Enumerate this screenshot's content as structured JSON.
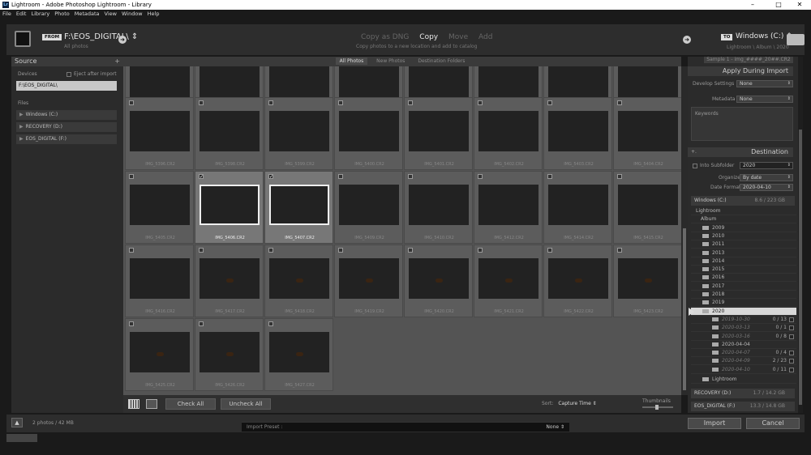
{
  "window": {
    "title": "Lightroom - Adobe Photoshop Lightroom - Library",
    "app_glyph": "Lr",
    "minimize": "–",
    "maximize": "□",
    "close": "✕"
  },
  "menu": [
    "File",
    "Edit",
    "Library",
    "Photo",
    "Metadata",
    "View",
    "Window",
    "Help"
  ],
  "topbar": {
    "from_label": "FROM",
    "from_path": "F:\\EOS_DIGITAL\\ ⇕",
    "from_sub": "All photos",
    "modes": [
      "Copy as DNG",
      "Copy",
      "Move",
      "Add"
    ],
    "active_mode": "Copy",
    "mode_sub": "Copy photos to a new location and add to catalog",
    "to_label": "TO",
    "to_path": "Windows (C:) ⇕",
    "to_sub": "Lightroom \\ Album \\ 2020",
    "arrow": "➜"
  },
  "source": {
    "title": "Source",
    "plus": "+",
    "devices_label": "Devices",
    "eject_label": "Eject after import",
    "selected_device": "F:\\EOS_DIGITAL\\",
    "files_label": "Files",
    "files": [
      {
        "name": "Windows (C:)"
      },
      {
        "name": "RECOVERY (D:)"
      },
      {
        "name": "EOS_DIGITAL (F:)"
      }
    ],
    "expand_glyph": "▶"
  },
  "grid": {
    "tabs": [
      "All Photos",
      "New Photos",
      "Destination Folders"
    ],
    "active_tab": "All Photos",
    "rows": [
      [
        {
          "label": "IMG_5387.CR2",
          "t": "t-grass",
          "sel": false
        },
        {
          "label": "IMG_5388.CR2",
          "t": "t-grass",
          "sel": false
        },
        {
          "label": "IMG_5389.CR2",
          "t": "t-grass",
          "sel": false
        },
        {
          "label": "IMG_5390.CR2",
          "t": "t-grass",
          "sel": false
        },
        {
          "label": "IMG_5391.CR2",
          "t": "t-grass",
          "sel": false
        },
        {
          "label": "IMG_5392.CR2",
          "t": "t-grass",
          "sel": false
        },
        {
          "label": "IMG_5393.CR2",
          "t": "t-grass",
          "sel": false
        },
        {
          "label": "IMG_5394.CR2",
          "t": "t-grass",
          "sel": false
        }
      ],
      [
        {
          "label": "IMG_5396.CR2",
          "t": "t-dark",
          "sel": false
        },
        {
          "label": "IMG_5398.CR2",
          "t": "t-grass",
          "sel": false
        },
        {
          "label": "IMG_5399.CR2",
          "t": "t-crocus2",
          "sel": false
        },
        {
          "label": "IMG_5400.CR2",
          "t": "t-crocus",
          "sel": false
        },
        {
          "label": "IMG_5401.CR2",
          "t": "t-crocus",
          "sel": false
        },
        {
          "label": "IMG_5402.CR2",
          "t": "t-crocus",
          "sel": false
        },
        {
          "label": "IMG_5403.CR2",
          "t": "t-crocus",
          "sel": false
        },
        {
          "label": "IMG_5404.CR2",
          "t": "t-crocus",
          "sel": false
        }
      ],
      [
        {
          "label": "IMG_5405.CR2",
          "t": "t-anem",
          "sel": false
        },
        {
          "label": "IMG_5406.CR2",
          "t": "t-anem",
          "sel": true
        },
        {
          "label": "IMG_5407.CR2",
          "t": "t-anem",
          "sel": true
        },
        {
          "label": "IMG_5409.CR2",
          "t": "t-yellow",
          "sel": false
        },
        {
          "label": "IMG_5410.CR2",
          "t": "t-yellow",
          "sel": false
        },
        {
          "label": "IMG_5412.CR2",
          "t": "t-yellow2",
          "sel": false
        },
        {
          "label": "IMG_5414.CR2",
          "t": "t-coltf",
          "sel": false
        },
        {
          "label": "IMG_5415.CR2",
          "t": "t-coltf",
          "sel": false
        }
      ],
      [
        {
          "label": "IMG_5416.CR2",
          "t": "t-black",
          "sel": false
        },
        {
          "label": "IMG_5417.CR2",
          "t": "t-bug",
          "sel": false,
          "bug": true
        },
        {
          "label": "IMG_5418.CR2",
          "t": "t-bug",
          "sel": false,
          "bug": true
        },
        {
          "label": "IMG_5419.CR2",
          "t": "t-bug2",
          "sel": false,
          "bug": true
        },
        {
          "label": "IMG_5420.CR2",
          "t": "t-bug2",
          "sel": false,
          "bug": true
        },
        {
          "label": "IMG_5421.CR2",
          "t": "t-bug2",
          "sel": false,
          "bug": true
        },
        {
          "label": "IMG_5422.CR2",
          "t": "t-bug3",
          "sel": false,
          "bug": true
        },
        {
          "label": "IMG_5423.CR2",
          "t": "t-bug3",
          "sel": false,
          "bug": true
        }
      ],
      [
        {
          "label": "IMG_5425.CR2",
          "t": "t-bug3",
          "sel": false,
          "bug": true
        },
        {
          "label": "IMG_5426.CR2",
          "t": "t-bug2",
          "sel": false,
          "bug": true
        },
        {
          "label": "IMG_5427.CR2",
          "t": "t-bug3",
          "sel": false,
          "bug": true
        }
      ]
    ],
    "check_glyph": "✓"
  },
  "grid_footer": {
    "check_all": "Check All",
    "uncheck_all": "Uncheck All",
    "sort_label": "Sort:",
    "sort_value": "Capture Time ⇕",
    "thumbnails_label": "Thumbnails"
  },
  "right": {
    "preset_top": "Sample 1 - img_####_20##.CR2",
    "apply_title": "Apply During Import",
    "develop_label": "Develop Settings",
    "develop_value": "None",
    "metadata_label": "Metadata",
    "metadata_value": "None",
    "keywords_label": "Keywords",
    "destination_title": "Destination",
    "plus": "+.",
    "into_subfolder_label": "Into Subfolder",
    "into_subfolder_value": "2020",
    "organize_label": "Organize",
    "organize_value": "By date",
    "date_format_label": "Date Format",
    "date_format_value": "2020-04-10",
    "volume": {
      "name": "Windows (C:)",
      "size": "8.6 / 223 GB"
    },
    "lightroom_label": "Lightroom",
    "album_label": "Album",
    "years": [
      "2009",
      "2010",
      "2011",
      "2013",
      "2014",
      "2015",
      "2016",
      "2017",
      "2018",
      "2019"
    ],
    "year_2020": "2020",
    "subfolders": [
      {
        "name": "2019-10-30",
        "count": "0 / 13",
        "dim": true
      },
      {
        "name": "2020-03-13",
        "count": "0 / 1",
        "dim": true
      },
      {
        "name": "2020-03-16",
        "count": "0 / 8",
        "dim": true
      },
      {
        "name": "2020-04-04",
        "count": "",
        "dim": false
      },
      {
        "name": "2020-04-07",
        "count": "0 / 4",
        "dim": true
      },
      {
        "name": "2020-04-09",
        "count": "2 / 23",
        "dim": true
      },
      {
        "name": "2020-04-10",
        "count": "0 / 11",
        "dim": true
      }
    ],
    "lightroom_folder": "Lightroom",
    "volumes_bottom": [
      {
        "name": "RECOVERY (D:)",
        "size": "1.7 / 14.2 GB"
      },
      {
        "name": "EOS_DIGITAL (F:)",
        "size": "13.3 / 14.8 GB"
      }
    ]
  },
  "bottom": {
    "up": "▲",
    "count": "2 photos / 42 MB",
    "preset_label": "Import Preset :",
    "preset_value": "None ⇕",
    "import_label": "Import",
    "cancel_label": "Cancel"
  }
}
